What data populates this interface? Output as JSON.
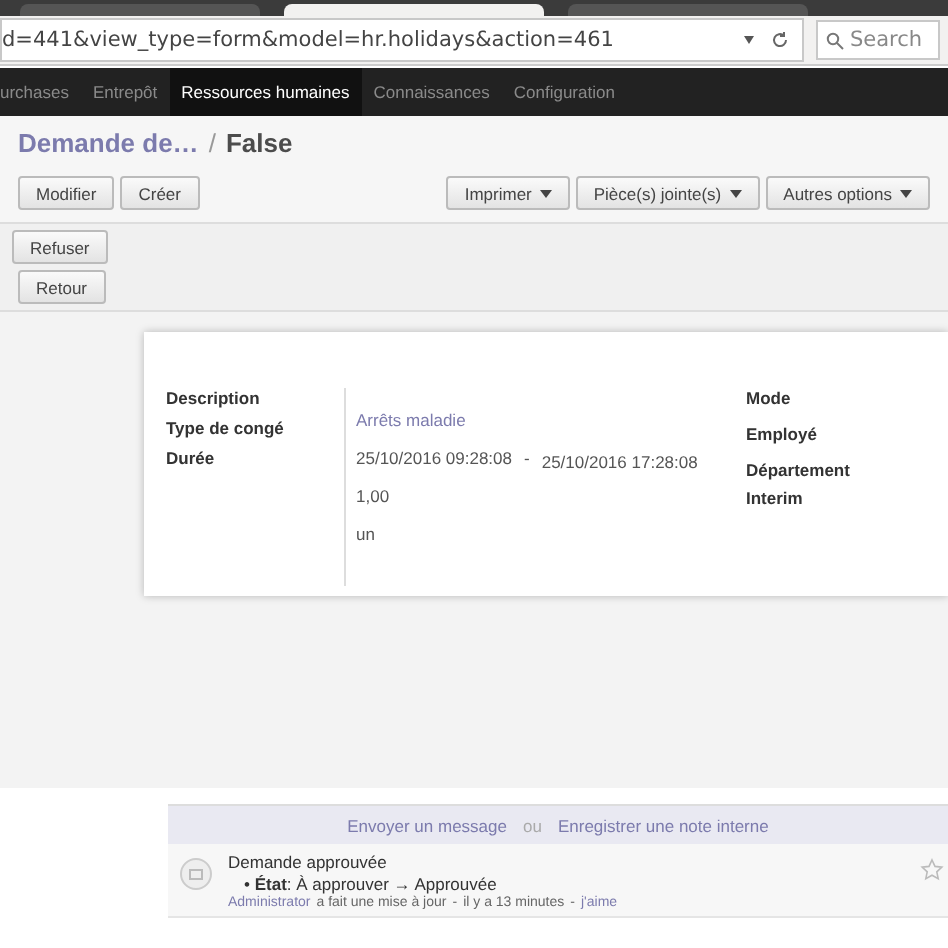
{
  "browser": {
    "url": "d=441&view_type=form&model=hr.holidays&action=461",
    "search": {
      "placeholder": "Search"
    }
  },
  "menu": [
    {
      "label": "urchases",
      "selected": false
    },
    {
      "label": "Entrepôt",
      "selected": false
    },
    {
      "label": "Ressources humaines",
      "selected": true
    },
    {
      "label": "Connaissances",
      "selected": false
    },
    {
      "label": "Configuration",
      "selected": false
    }
  ],
  "breadcrumb": {
    "parent": "Demande de…",
    "separator": "/",
    "current": "False"
  },
  "buttons_left": [
    "Modifier",
    "Créer"
  ],
  "buttons_right": [
    "Imprimer",
    "Pièce(s) jointe(s)",
    "Autres options"
  ],
  "workflow_buttons": [
    "Refuser",
    "Retour"
  ],
  "form": {
    "left_labels": [
      "Description",
      "Type de congé",
      "Durée"
    ],
    "leave_type": "Arrêts maladie",
    "date_from": "25/10/2016 09:28:08",
    "separator": "-",
    "date_to": "25/10/2016 17:28:08",
    "duration": "1,00",
    "unit": "un",
    "right_labels": [
      "Mode",
      "Employé",
      "Département",
      "Interim"
    ]
  },
  "chatter": {
    "send_message": "Envoyer un message",
    "or": "ou",
    "log_note": "Enregistrer une note interne",
    "messages": [
      {
        "title": "Demande approuvée",
        "bullet": "•",
        "change": "**État**: À approuver → Approuvée",
        "author": "Administrator",
        "action": "a fait une mise à jour",
        "sep1": "-",
        "time": "il y a 13 minutes",
        "sep2": "-",
        "like": "j'aime"
      }
    ]
  }
}
